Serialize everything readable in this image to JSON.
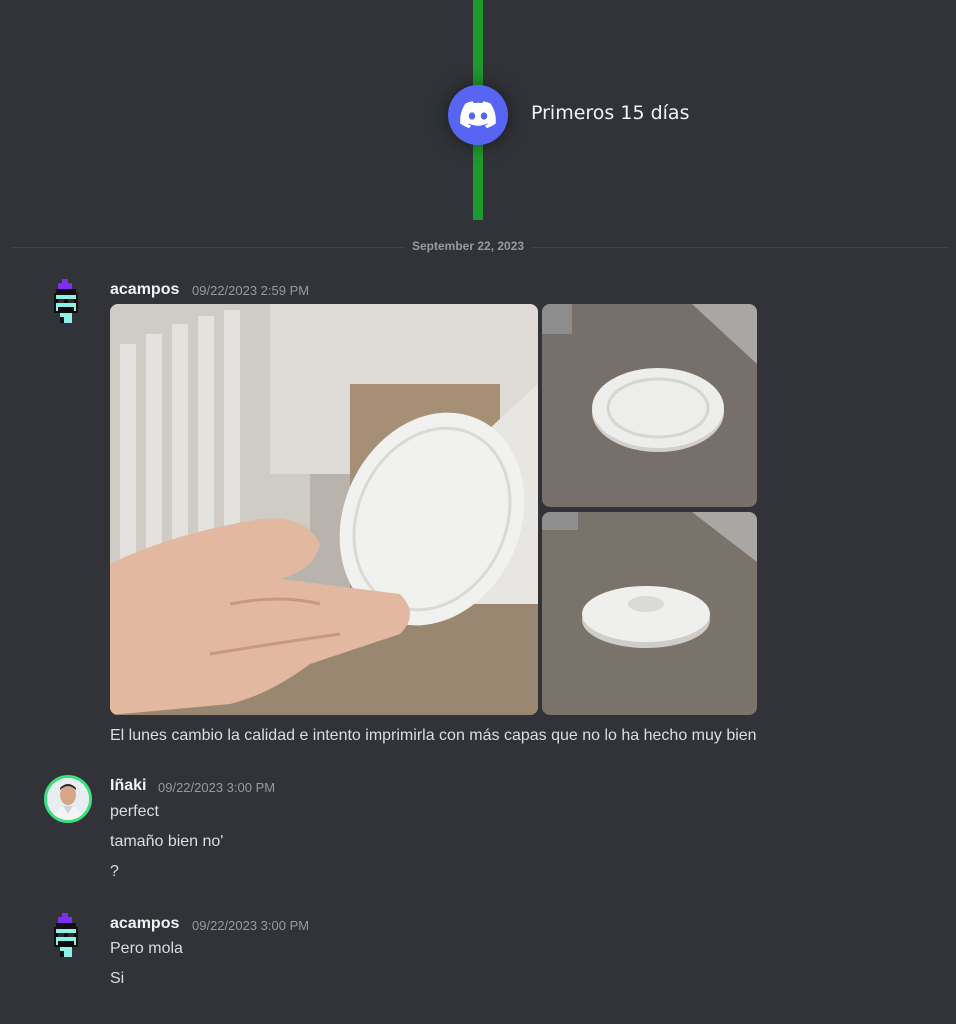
{
  "header": {
    "title": "Primeros 15 días",
    "icon": "discord-logo-icon",
    "line_color": "#1f9a2e",
    "badge_color": "#5865f2"
  },
  "divider": {
    "date": "September 22, 2023"
  },
  "messages": [
    {
      "author": "acampos",
      "timestamp": "09/22/2023 2:59 PM",
      "attachments": [
        "coin-in-hand",
        "coin-on-counter-top",
        "coin-on-counter-side"
      ],
      "lines": [
        "El lunes cambio la calidad e intento imprimirla con más capas que no lo ha hecho muy bien"
      ]
    },
    {
      "author": "Iñaki",
      "timestamp": "09/22/2023 3:00 PM",
      "lines": [
        "perfect",
        "tamaño bien no'",
        "?"
      ]
    },
    {
      "author": "acampos",
      "timestamp": "09/22/2023 3:00 PM",
      "lines": [
        "Pero mola",
        "Si"
      ]
    }
  ]
}
